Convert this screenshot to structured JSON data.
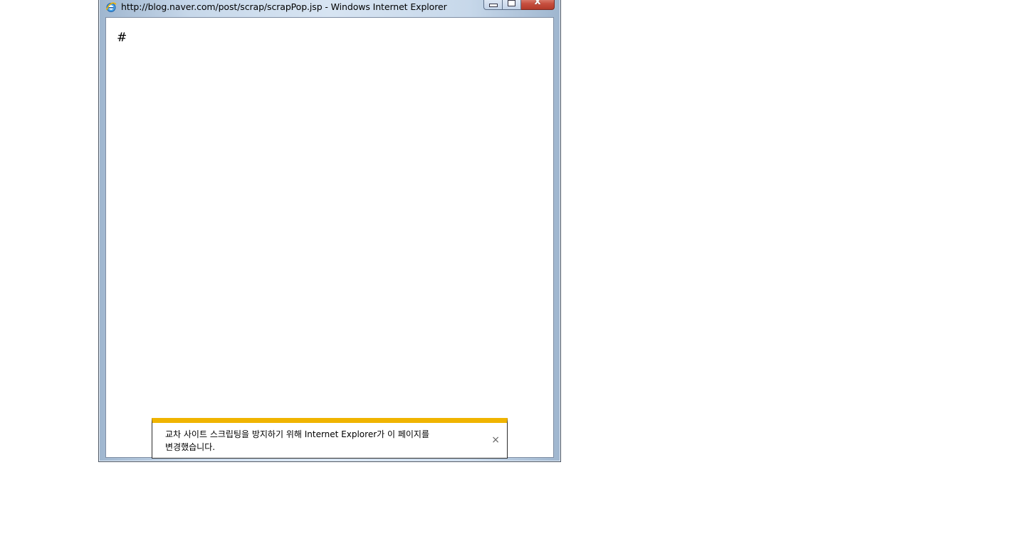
{
  "window": {
    "title": "http://blog.naver.com/post/scrap/scrapPop.jsp - Windows Internet Explorer",
    "icon": "ie-icon",
    "controls": {
      "minimize_icon": "minimize-icon",
      "maximize_icon": "maximize-icon",
      "close_label": "x"
    }
  },
  "page": {
    "text": "#"
  },
  "notification": {
    "message_line1": "교차 사이트 스크립팅을 방지하기 위해 Internet Explorer가 이 페이지를",
    "message_line2": "변경했습니다.",
    "close_label": "×",
    "accent_color": "#f0b400"
  }
}
